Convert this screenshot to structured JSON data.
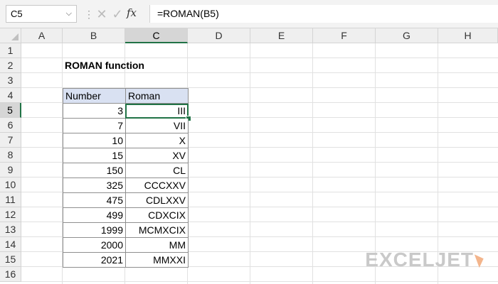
{
  "formula_bar": {
    "name_box": "C5",
    "fx_label": "fx",
    "formula": "=ROMAN(B5)"
  },
  "columns": [
    "A",
    "B",
    "C",
    "D",
    "E",
    "F",
    "G",
    "H"
  ],
  "rows": [
    "1",
    "2",
    "3",
    "4",
    "5",
    "6",
    "7",
    "8",
    "9",
    "10",
    "11",
    "12",
    "13",
    "14",
    "15",
    "16"
  ],
  "sheet": {
    "title": "ROMAN function",
    "headers": {
      "number": "Number",
      "roman": "Roman"
    },
    "data": [
      {
        "number": "3",
        "roman": "III"
      },
      {
        "number": "7",
        "roman": "VII"
      },
      {
        "number": "10",
        "roman": "X"
      },
      {
        "number": "15",
        "roman": "XV"
      },
      {
        "number": "150",
        "roman": "CL"
      },
      {
        "number": "325",
        "roman": "CCCXXV"
      },
      {
        "number": "475",
        "roman": "CDLXXV"
      },
      {
        "number": "499",
        "roman": "CDXCIX"
      },
      {
        "number": "1999",
        "roman": "MCMXCIX"
      },
      {
        "number": "2000",
        "roman": "MM"
      },
      {
        "number": "2021",
        "roman": "MMXXI"
      }
    ]
  },
  "logo": {
    "text": "EXCELJET"
  },
  "colors": {
    "accent": "#217346",
    "table_header": "#d9e1f2"
  }
}
